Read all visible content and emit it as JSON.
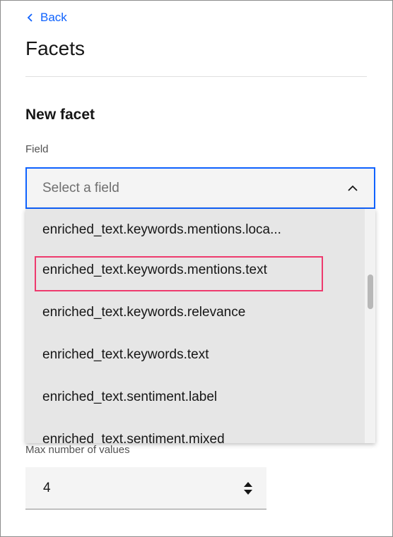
{
  "nav": {
    "back_label": "Back"
  },
  "page": {
    "title": "Facets"
  },
  "new_facet": {
    "section_title": "New facet",
    "field_label": "Field",
    "field_placeholder": "Select a field",
    "dropdown_options": [
      "enriched_text.keywords.mentions.loca...",
      "enriched_text.keywords.mentions.text",
      "enriched_text.keywords.relevance",
      "enriched_text.keywords.text",
      "enriched_text.sentiment.label",
      "enriched_text.sentiment.mixed"
    ],
    "highlighted_option": "enriched_text.keywords.mentions.text",
    "max_values_label": "Max number of values",
    "max_values_value": "4"
  },
  "colors": {
    "accent": "#0f62fe",
    "highlight_border": "#ee3a6e",
    "dropdown_bg": "#e6e6e6",
    "field_bg": "#f4f4f4"
  },
  "icons": {
    "back": "chevron-left-icon",
    "select": "chevron-up-icon",
    "stepper": "number-stepper-icon"
  }
}
